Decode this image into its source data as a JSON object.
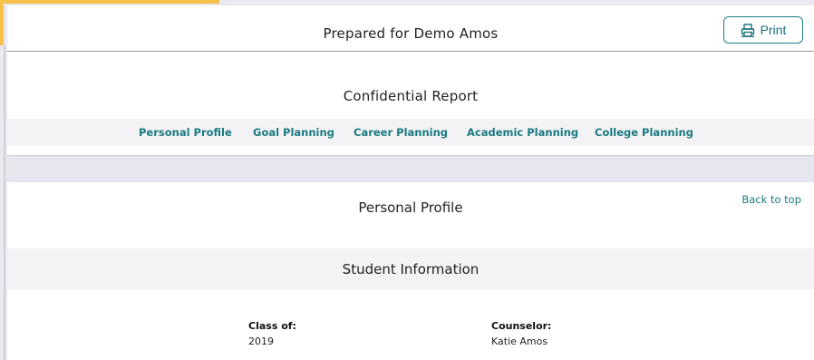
{
  "header": {
    "prepared_for": "Prepared for Demo Amos",
    "print_label": "Print",
    "print_icon": "printer-icon"
  },
  "report": {
    "title": "Confidential Report",
    "nav": [
      {
        "label": "Personal Profile"
      },
      {
        "label": "Goal Planning"
      },
      {
        "label": "Career Planning"
      },
      {
        "label": "Academic Planning"
      },
      {
        "label": "College Planning"
      }
    ]
  },
  "profile": {
    "title": "Personal Profile",
    "back_to_top": "Back to top",
    "section_title": "Student Information",
    "fields": [
      {
        "label": "Class of:",
        "value": "2019"
      },
      {
        "label": "Counselor:",
        "value": "Katie Amos"
      }
    ]
  },
  "colors": {
    "accent": "#f6c24a",
    "link": "#1b7a80",
    "strip": "#f3f3f6"
  }
}
